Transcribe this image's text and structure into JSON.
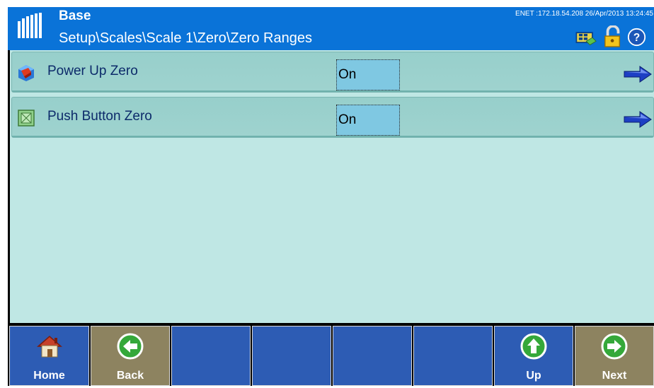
{
  "header": {
    "title": "Base",
    "breadcrumb": "Setup\\Scales\\Scale 1\\Zero\\Zero Ranges",
    "status": "ENET :172.18.54.208  26/Apr/2013 13:24:45",
    "icons": [
      "network-icon",
      "lock-icon",
      "help-icon"
    ]
  },
  "rows": [
    {
      "label": "Power Up Zero",
      "value": "On",
      "icon": "power-up-zero-icon"
    },
    {
      "label": "Push Button Zero",
      "value": "On",
      "icon": "push-button-zero-icon"
    }
  ],
  "toolbar": {
    "home_label": "Home",
    "back_label": "Back",
    "up_label": "Up",
    "next_label": "Next"
  },
  "colors": {
    "header": "#0a73d8",
    "content": "#bfe7e4",
    "row": "#9fd3cf",
    "value_box": "#7fc8e2",
    "toolbar_blue": "#2d5cb4",
    "toolbar_tan": "#8d8360",
    "green_button": "#35a83a"
  }
}
